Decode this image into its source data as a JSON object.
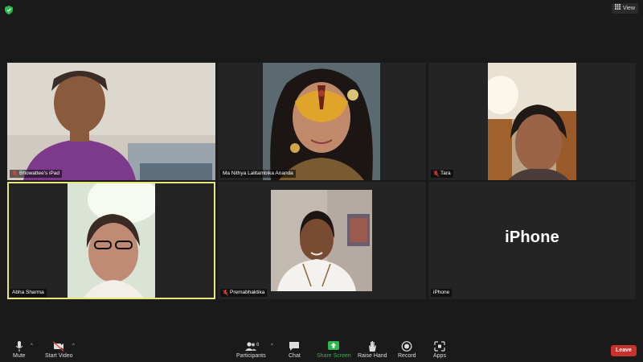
{
  "topbar": {
    "view_label": "View",
    "security_icon": "shield-check-icon",
    "view_icon": "grid-icon"
  },
  "participants": [
    {
      "name": "Bhowattee's iPad",
      "muted": true
    },
    {
      "name": "Ma Nithya Lalitambika Ananda",
      "muted": false
    },
    {
      "name": "Tara",
      "muted": true
    },
    {
      "name": "Abha Sharma",
      "muted": false,
      "active_speaker": true
    },
    {
      "name": "Premabhaktika",
      "muted": true
    },
    {
      "name": "iPhone",
      "muted": false,
      "video_off": true,
      "display_text": "iPhone"
    }
  ],
  "toolbar": {
    "mute": "Mute",
    "start_video": "Start Video",
    "participants": "Participants",
    "participants_count": "6",
    "chat": "Chat",
    "share_screen": "Share Screen",
    "raise_hand": "Raise Hand",
    "record": "Record",
    "apps": "Apps",
    "leave": "Leave"
  },
  "colors": {
    "background": "#1a1a1a",
    "tile": "#242424",
    "active_speaker_border": "#e8e87a",
    "share_screen": "#2db84d",
    "leave": "#c8322b",
    "muted_icon": "#e0443a"
  }
}
